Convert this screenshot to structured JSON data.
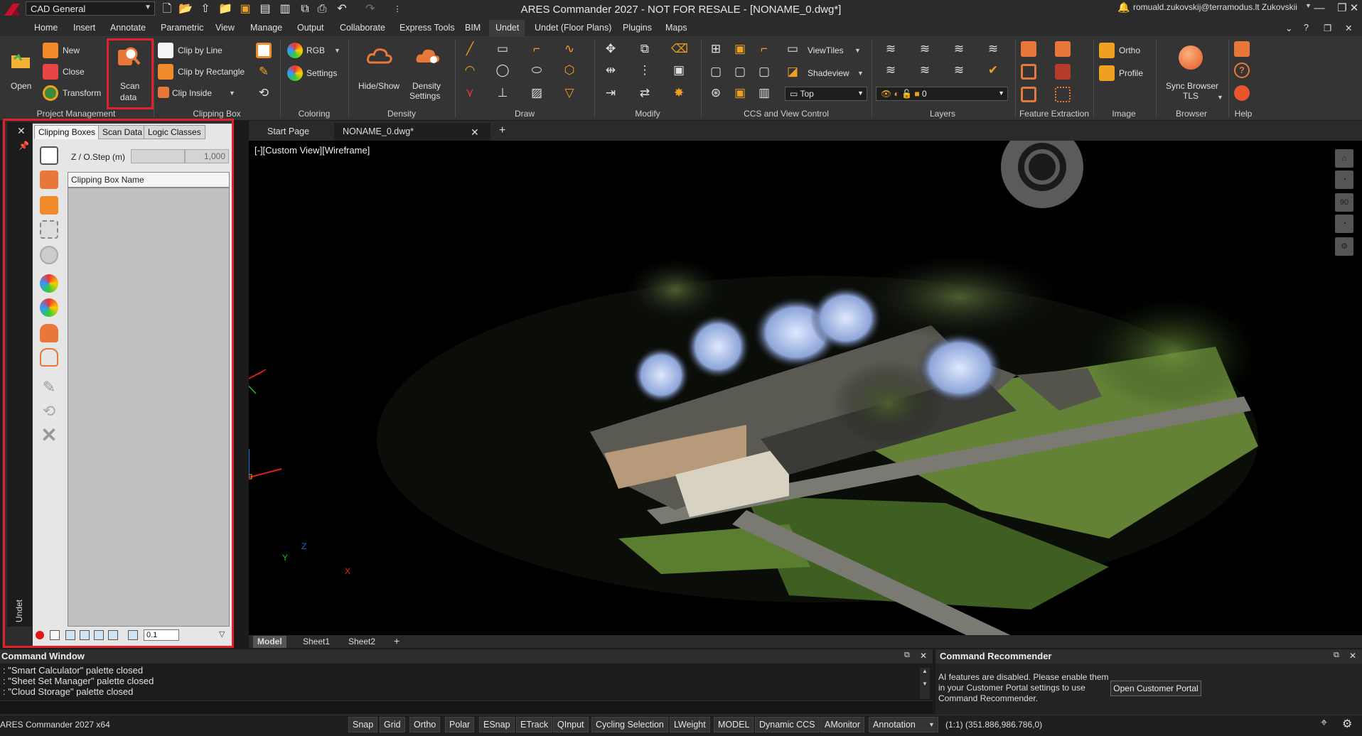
{
  "title_bar": {
    "workspace": "CAD General",
    "app_title": "ARES Commander 2027 - NOT FOR RESALE - [NONAME_0.dwg*]",
    "user": "romuald.zukovskij@terramodus.lt Zukovskii"
  },
  "menubar": {
    "items": [
      "Home",
      "Insert",
      "Annotate",
      "Parametric",
      "View",
      "Manage",
      "Output",
      "Collaborate",
      "Express Tools",
      "BIM",
      "Undet",
      "Undet (Floor Plans)",
      "Plugins",
      "Maps"
    ],
    "active": "Undet"
  },
  "ribbon": {
    "groups": {
      "project_management": "Project Management",
      "clipping_box": "Clipping Box",
      "coloring": "Coloring",
      "density": "Density",
      "draw": "Draw",
      "modify": "Modify",
      "ccs_view": "CCS and View Control",
      "layers": "Layers",
      "feature_extraction": "Feature Extraction",
      "image": "Image",
      "browser": "Browser",
      "help": "Help"
    },
    "buttons": {
      "open": "Open",
      "new": "New",
      "close": "Close",
      "transform": "Transform",
      "scan_data_1": "Scan",
      "scan_data_2": "data",
      "clip_by_line": "Clip by Line",
      "clip_by_rectangle": "Clip by Rectangle",
      "clip_inside": "Clip Inside",
      "rgb": "RGB",
      "settings": "Settings",
      "hide_show": "Hide/Show",
      "density_settings_1": "Density",
      "density_settings_2": "Settings",
      "viewtiles": "ViewTiles",
      "shadeview": "Shadeview",
      "view_select": "Top",
      "layer_value": "0",
      "ortho": "Ortho",
      "profile": "Profile",
      "sync_browser_1": "Sync Browser",
      "sync_browser_2": "TLS"
    }
  },
  "left_panel": {
    "side_label": "Undet",
    "tabs": [
      "Clipping Boxes",
      "Scan Data",
      "Logic Classes"
    ],
    "active_tab": "Clipping Boxes",
    "zstep_label": "Z / O.Step (m)",
    "zstep_value": "1,000",
    "column_header": "Clipping Box Name",
    "bottom_value": "0.1"
  },
  "doc_tabs": {
    "tabs": [
      "Start Page",
      "NONAME_0.dwg*"
    ]
  },
  "viewport": {
    "label": "[-][Custom View][Wireframe]",
    "navbar_zoom": "90",
    "axis_x": "X",
    "axis_y": "Y",
    "axis_z": "Z"
  },
  "sheet_tabs": {
    "tabs": [
      "Model",
      "Sheet1",
      "Sheet2"
    ],
    "active": "Model"
  },
  "command_window": {
    "title": "Command Window",
    "lines": [
      ": \"Smart Calculator\" palette closed",
      ": \"Sheet Set Manager\" palette closed",
      ": \"Cloud Storage\" palette closed"
    ]
  },
  "command_recommender": {
    "title": "Command Recommender",
    "message": "AI features are disabled. Please enable them in your Customer Portal settings to use Command Recommender.",
    "button": "Open Customer Portal"
  },
  "status_bar": {
    "product": "ARES Commander 2027 x64",
    "buttons": [
      "Snap",
      "Grid",
      "Ortho",
      "Polar",
      "ESnap",
      "ETrack",
      "QInput",
      "Cycling Selection",
      "LWeight",
      "MODEL",
      "Dynamic CCS",
      "AMonitor",
      "Annotation"
    ],
    "scale": "(1:1)",
    "coords": "(351.886,986.786,0)"
  },
  "colors": {
    "highlight_box": "#e0202a",
    "ribbon_bg": "#343434",
    "viewport_bg": "#000000"
  }
}
